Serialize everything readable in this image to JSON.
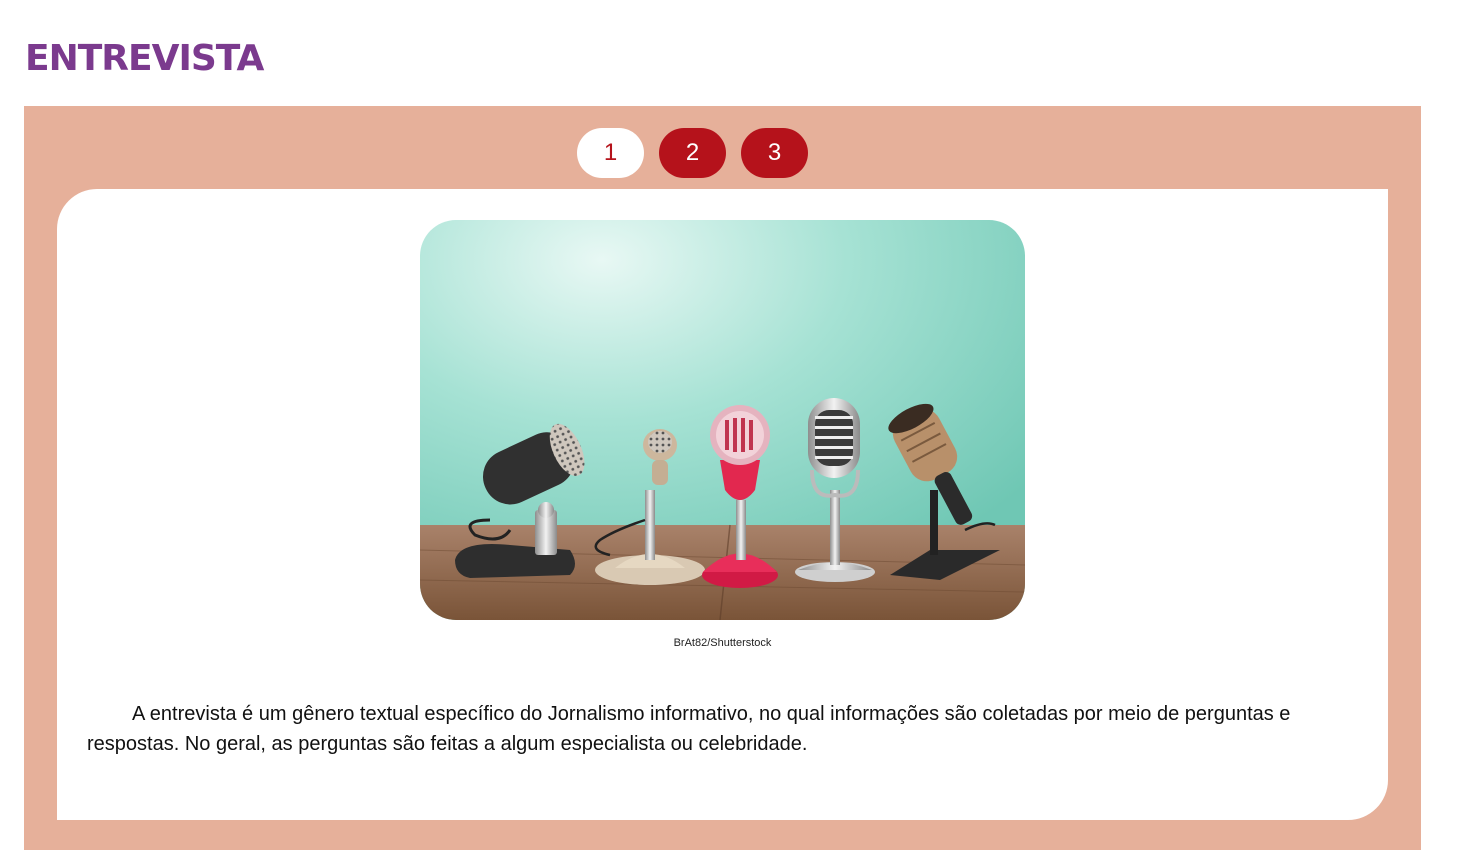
{
  "page": {
    "title": "ENTREVISTA"
  },
  "tabs": [
    {
      "label": "1",
      "active": true
    },
    {
      "label": "2",
      "active": false
    },
    {
      "label": "3",
      "active": false
    }
  ],
  "content": {
    "image": {
      "credit": "BrAt82/Shutterstock"
    },
    "paragraph": "A entrevista é um gênero textual específico do Jornalismo informativo, no qual informações são coletadas por meio de perguntas e respostas. No geral, as perguntas são feitas a algum especialista ou celebridade."
  },
  "colors": {
    "title": "#7b3a8e",
    "panel": "#e6b09a",
    "accent": "#b5121b"
  }
}
